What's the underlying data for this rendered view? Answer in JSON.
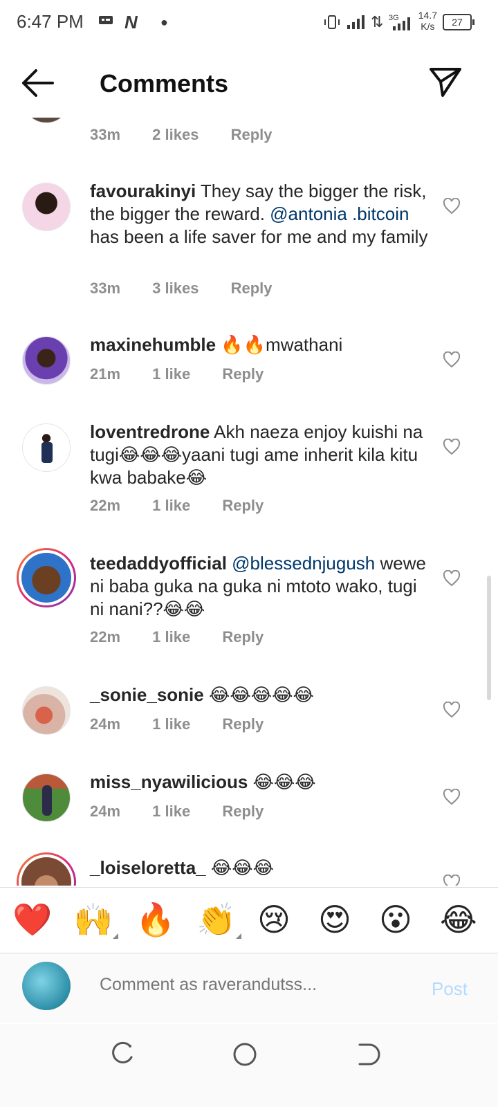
{
  "status_bar": {
    "time": "6:47 PM",
    "network_type": "3G",
    "speed_value": "14.7",
    "speed_unit": "K/s",
    "battery": "27"
  },
  "header": {
    "title": "Comments"
  },
  "comments": [
    {
      "time": "33m",
      "likes": "2 likes",
      "reply": "Reply"
    },
    {
      "username": "favourakinyi",
      "text_a": " They say the bigger the risk, the bigger the reward. ",
      "mention": "@antonia .bitcoin",
      "text_b": " has been a life saver for me and my family",
      "time": "33m",
      "likes": "3 likes",
      "reply": "Reply"
    },
    {
      "username": "maxinehumble",
      "text": " 🔥🔥mwathani",
      "time": "21m",
      "likes": "1 like",
      "reply": "Reply"
    },
    {
      "username": "loventredrone",
      "text": " Akh naeza enjoy kuishi na tugi😂😂😂yaani tugi ame inherit kila kitu kwa babake😂",
      "time": "22m",
      "likes": "1 like",
      "reply": "Reply"
    },
    {
      "username": "teedaddyofficial",
      "mention": " @blessednjugush",
      "text": " wewe ni baba guka na guka ni mtoto wako, tugi ni nani??😂😂",
      "time": "22m",
      "likes": "1 like",
      "reply": "Reply"
    },
    {
      "username": "_sonie_sonie",
      "text": " 😂😂😂😂😂",
      "time": "24m",
      "likes": "1 like",
      "reply": "Reply"
    },
    {
      "username": "miss_nyawilicious",
      "text": " 😂😂😂",
      "time": "24m",
      "likes": "1 like",
      "reply": "Reply"
    },
    {
      "username": "_loiseloretta_",
      "text": " 😂😂😂"
    }
  ],
  "reactions": [
    "❤️",
    "🙌",
    "🔥",
    "👏",
    "😢",
    "😍",
    "😮",
    "😂"
  ],
  "composer": {
    "placeholder": "Comment as raverandutss...",
    "post_label": "Post"
  },
  "icons": {
    "back": "arrow-left",
    "send": "paper-plane",
    "heart": "heart-outline"
  }
}
